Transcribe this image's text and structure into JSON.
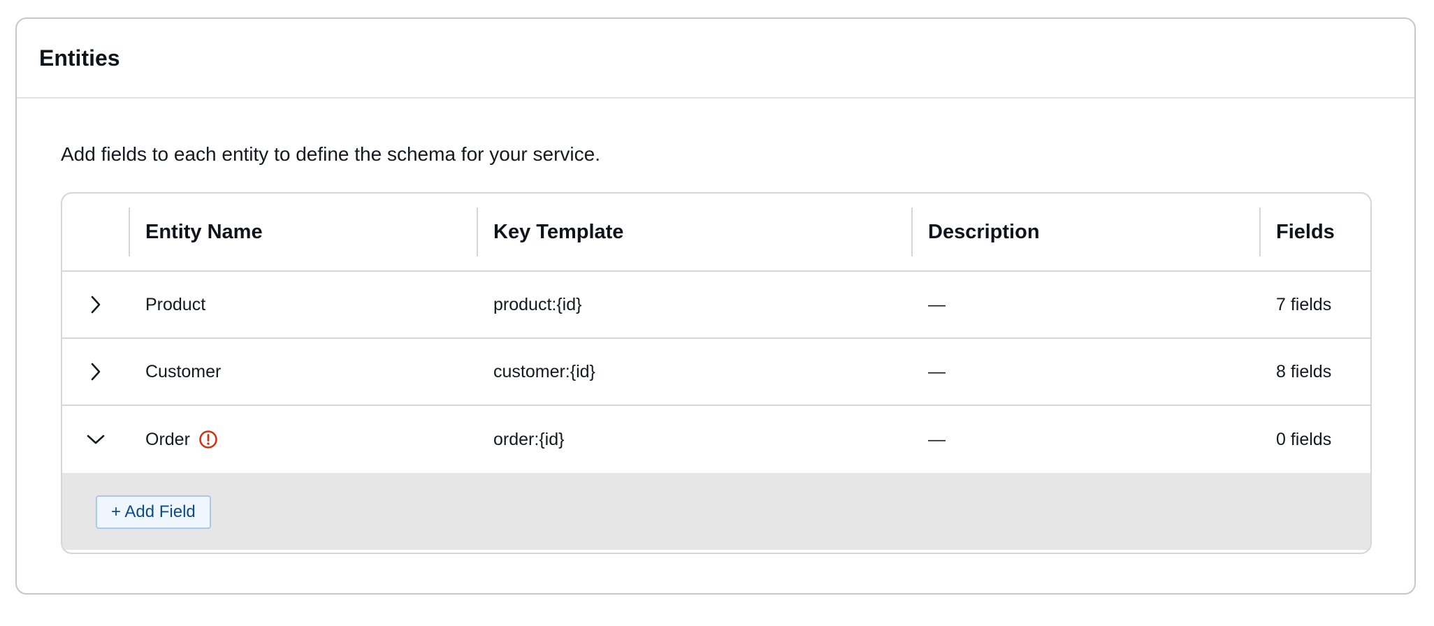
{
  "panel": {
    "title": "Entities",
    "intro": "Add fields to each entity to define the schema for your service."
  },
  "table": {
    "columns": [
      "Entity Name",
      "Key Template",
      "Description",
      "Fields"
    ],
    "rows": [
      {
        "name": "Product",
        "key_template": "product:{id}",
        "description": "—",
        "fields": "7 fields",
        "expanded": false,
        "warning": false
      },
      {
        "name": "Customer",
        "key_template": "customer:{id}",
        "description": "—",
        "fields": "8 fields",
        "expanded": false,
        "warning": false
      },
      {
        "name": "Order",
        "key_template": "order:{id}",
        "description": "—",
        "fields": "0 fields",
        "expanded": true,
        "warning": true
      }
    ]
  },
  "expanded_panel": {
    "add_field_label": "+ Add Field"
  },
  "icons": {
    "collapsed": "chevron-right-icon",
    "expanded": "chevron-down-icon",
    "warning": "warning-circle-icon"
  },
  "colors": {
    "warning": "#d13212",
    "button_text": "#0b4b8f",
    "button_border": "#a9c8ec",
    "button_bg": "#f0f6fd",
    "expanded_bg": "#e6e6e6"
  }
}
